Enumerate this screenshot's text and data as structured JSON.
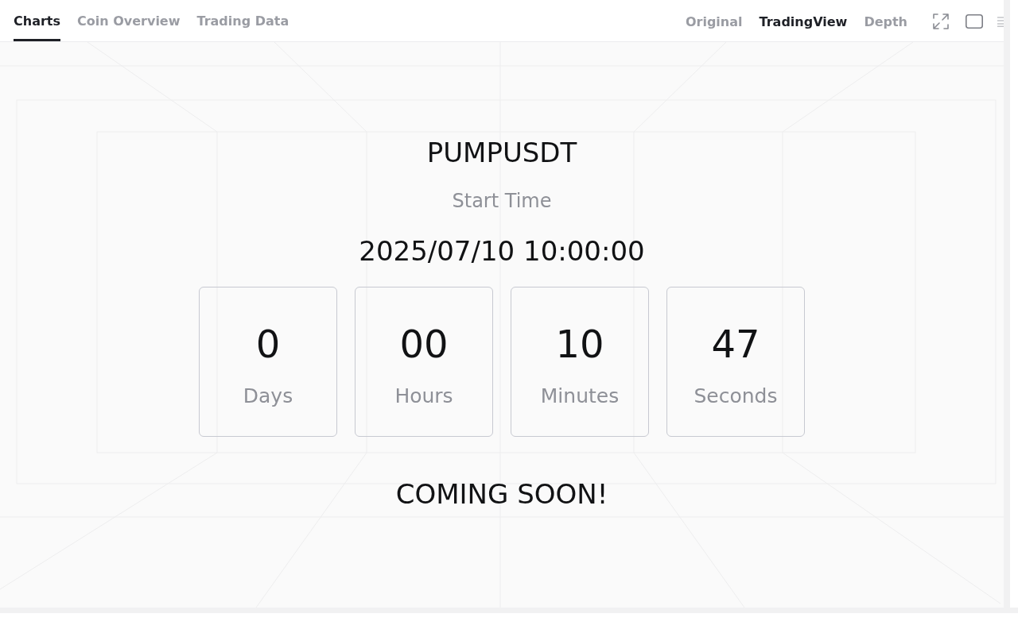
{
  "tabs": [
    {
      "label": "Charts",
      "selected": true
    },
    {
      "label": "Coin Overview",
      "selected": false
    },
    {
      "label": "Trading Data",
      "selected": false
    }
  ],
  "view_modes": [
    {
      "label": "Original",
      "selected": false
    },
    {
      "label": "TradingView",
      "selected": true
    },
    {
      "label": "Depth",
      "selected": false
    }
  ],
  "listing": {
    "symbol": "PUMPUSDT",
    "start_label": "Start Time",
    "start_time": "2025/07/10 10:00:00",
    "countdown": [
      {
        "value": "0",
        "unit": "Days"
      },
      {
        "value": "00",
        "unit": "Hours"
      },
      {
        "value": "10",
        "unit": "Minutes"
      },
      {
        "value": "47",
        "unit": "Seconds"
      }
    ],
    "status": "COMING SOON!"
  }
}
